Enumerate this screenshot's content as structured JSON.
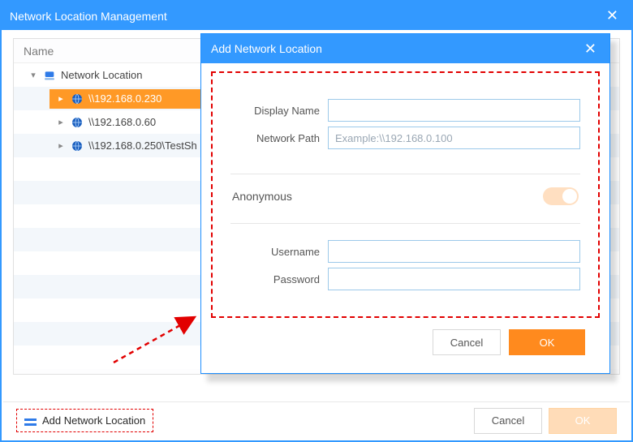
{
  "main": {
    "title": "Network Location Management",
    "column_header": "Name",
    "tree": {
      "root_label": "Network Location",
      "items": [
        {
          "label": "\\\\192.168.0.230",
          "selected": true
        },
        {
          "label": "\\\\192.168.0.60",
          "selected": false
        },
        {
          "label": "\\\\192.168.0.250\\TestSh",
          "selected": false
        }
      ]
    },
    "add_button_label": "Add Network Location",
    "cancel_label": "Cancel",
    "ok_label": "OK"
  },
  "dialog": {
    "title": "Add Network Location",
    "display_name_label": "Display Name",
    "display_name_value": "",
    "network_path_label": "Network Path",
    "network_path_value": "",
    "network_path_placeholder": "Example:\\\\192.168.0.100",
    "anonymous_label": "Anonymous",
    "username_label": "Username",
    "username_value": "",
    "password_label": "Password",
    "password_value": "",
    "cancel_label": "Cancel",
    "ok_label": "OK"
  },
  "colors": {
    "accent_blue": "#3399ff",
    "accent_orange": "#ff8a1e",
    "highlight_red": "#e20000"
  }
}
